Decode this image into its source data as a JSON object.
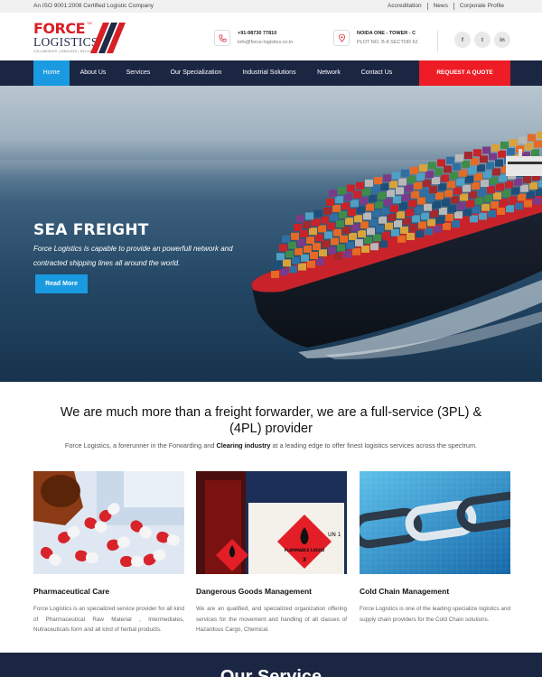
{
  "topbar": {
    "certification": "An ISO 9001:2008 Certified Logistic Company",
    "links": [
      "Accreditation",
      "News",
      "Corporate Profile"
    ]
  },
  "logo": {
    "force": "FORCE",
    "tm": "TM",
    "logistics": "LOGISTICS",
    "tagline": "COLLABORATE | INNOVATE | DELIVER"
  },
  "contact": {
    "phone": "+91-98730 77810",
    "email": "info@force-logistics.co.in",
    "address_line1": "NOIDA ONE - TOWER - C",
    "address_line2": "PLOT NO. B-8 SECTOR 62"
  },
  "social": {
    "facebook": "f",
    "twitter": "t",
    "linkedin": "in"
  },
  "nav": {
    "items": [
      "Home",
      "About Us",
      "Services",
      "Our Specialization",
      "Industrial Solutions",
      "Network",
      "Contact Us"
    ],
    "active": "Home",
    "quote": "REQUEST A QUOTE"
  },
  "hero": {
    "title": "SEA FREIGHT",
    "text": "Force Logistics is capable to provide an powerfull network and contracted shipping lines all around the world.",
    "button": "Read More"
  },
  "intro": {
    "title": "We are much more than a freight forwarder, we are a full-service (3PL) & (4PL) provider",
    "text_before": "Force Logistics, a forerunner in the Forwarding and ",
    "text_bold": "Clearing industry",
    "text_after": " at a leading edge to offer finest logistics services across the spectrum."
  },
  "cards": [
    {
      "title": "Pharmaceutical Care",
      "text": "Force Logistics is an specialized service provider for all kind of Pharmaceutical Raw Material , Intermediates, Nutraceuticals form and all kind of herbal products."
    },
    {
      "title": "Dangerous Goods Management",
      "text": "We are an qualified, and specialized organization offering services for the movement and handling of all classes of Hazardous Cargo, Chemical.",
      "label_un": "UN 1",
      "label_flammable": "FLAMMABLE LIQUID",
      "label_class": "3"
    },
    {
      "title": "Cold Chain Management",
      "text": "Force Logistics is one of the leading specialize logistics and supply chain providers for the Cold Chain solutions."
    }
  ],
  "services": {
    "title": "Our Service"
  },
  "colors": {
    "navy": "#1a2642",
    "accent_blue": "#1a9ae0",
    "accent_red": "#ee1c25",
    "brand_red": "#d81f26"
  }
}
